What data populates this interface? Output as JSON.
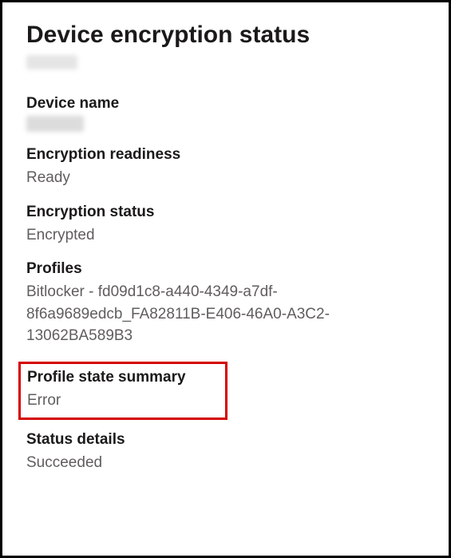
{
  "page": {
    "title": "Device encryption status"
  },
  "fields": {
    "deviceName": {
      "label": "Device name"
    },
    "readiness": {
      "label": "Encryption readiness",
      "value": "Ready"
    },
    "status": {
      "label": "Encryption status",
      "value": "Encrypted"
    },
    "profiles": {
      "label": "Profiles",
      "value": "Bitlocker - fd09d1c8-a440-4349-a7df-8f6a9689edcb_FA82811B-E406-46A0-A3C2-13062BA589B3"
    },
    "profileStateSummary": {
      "label": "Profile state summary",
      "value": "Error"
    },
    "statusDetails": {
      "label": "Status details",
      "value": "Succeeded"
    }
  }
}
